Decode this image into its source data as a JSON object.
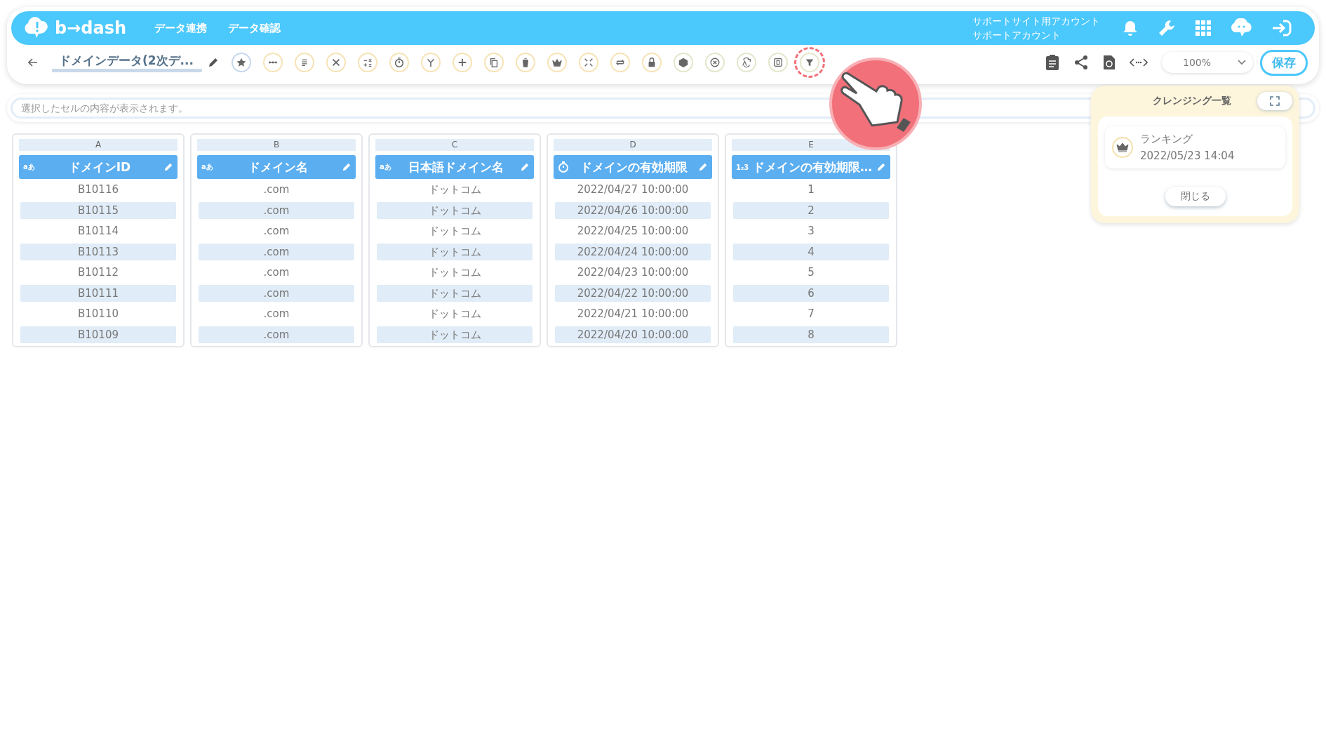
{
  "header": {
    "logo": "b→dash",
    "nav": [
      "データ連携",
      "データ確認"
    ],
    "account": [
      "サポートサイト用アカウント",
      "サポートアカウント"
    ]
  },
  "toolbar": {
    "title": "ドメインデータ(2次デ...",
    "tools": [
      {
        "highlighted": false
      },
      {
        "highlighted": false
      },
      {
        "highlighted": false
      },
      {
        "highlighted": false
      },
      {
        "highlighted": false
      },
      {
        "highlighted": false
      },
      {
        "highlighted": false
      },
      {
        "highlighted": false
      },
      {
        "highlighted": false
      },
      {
        "highlighted": false
      },
      {
        "highlighted": false
      },
      {
        "highlighted": false
      },
      {
        "highlighted": false
      },
      {
        "highlighted": false
      },
      {
        "highlighted": false
      },
      {
        "highlighted": false
      },
      {
        "highlighted": false
      },
      {
        "highlighted": false
      },
      {
        "highlighted": true
      }
    ],
    "zoom": "100%",
    "save": "保存"
  },
  "cell_bar": {
    "placeholder": "選択したセルの内容が表示されます。"
  },
  "table": {
    "columns": [
      {
        "letter": "A",
        "kind": "text",
        "badge": "aあ",
        "name": "ドメインID",
        "cells": [
          "B10116",
          "B10115",
          "B10114",
          "B10113",
          "B10112",
          "B10111",
          "B10110",
          "B10109"
        ]
      },
      {
        "letter": "B",
        "kind": "text",
        "badge": "aあ",
        "name": "ドメイン名",
        "cells": [
          ".com",
          ".com",
          ".com",
          ".com",
          ".com",
          ".com",
          ".com",
          ".com"
        ]
      },
      {
        "letter": "C",
        "kind": "text",
        "badge": "aあ",
        "name": "日本語ドメイン名",
        "cells": [
          "ドットコム",
          "ドットコム",
          "ドットコム",
          "ドットコム",
          "ドットコム",
          "ドットコム",
          "ドットコム",
          "ドットコム"
        ]
      },
      {
        "letter": "D",
        "kind": "datetime",
        "name": "ドメインの有効期限",
        "cells": [
          "2022/04/27 10:00:00",
          "2022/04/26 10:00:00",
          "2022/04/25 10:00:00",
          "2022/04/24 10:00:00",
          "2022/04/23 10:00:00",
          "2022/04/22 10:00:00",
          "2022/04/21 10:00:00",
          "2022/04/20 10:00:00"
        ]
      },
      {
        "letter": "E",
        "kind": "number",
        "badge": "1₂3",
        "name": "ドメインの有効期限…",
        "cells": [
          "1",
          "2",
          "3",
          "4",
          "5",
          "6",
          "7",
          "8"
        ]
      }
    ]
  },
  "cleansing_panel": {
    "title": "クレンジング一覧",
    "items": [
      {
        "name": "ランキング",
        "date": "2022/05/23 14:04"
      }
    ],
    "close": "閉じる"
  }
}
